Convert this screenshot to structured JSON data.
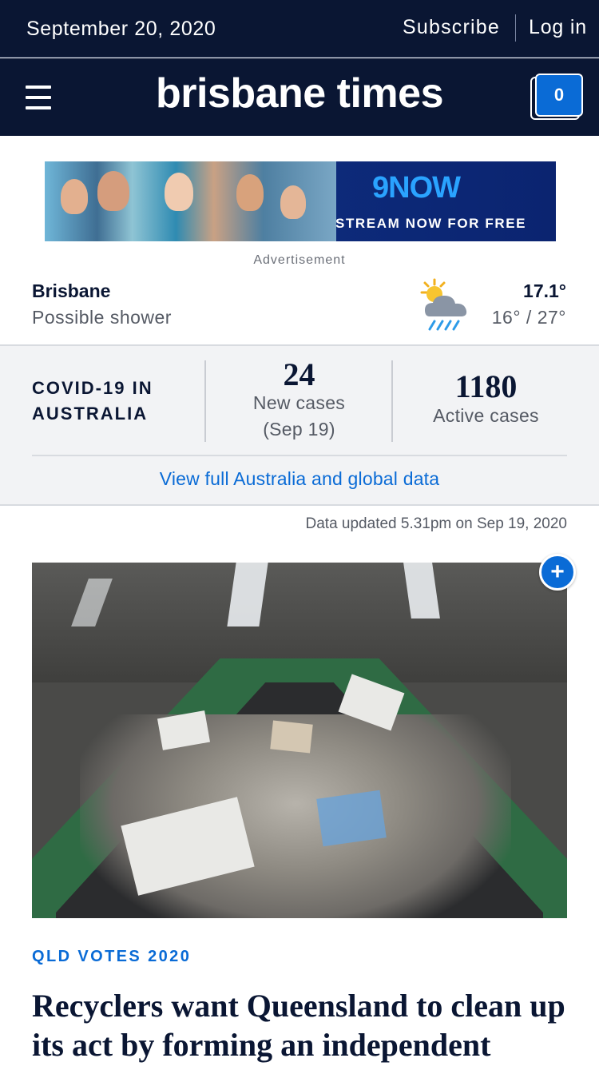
{
  "header": {
    "date": "September 20, 2020",
    "subscribe_label": "Subscribe",
    "login_label": "Log in"
  },
  "masthead": {
    "logo_text": "brisbane times",
    "menu_icon": "hamburger-menu-icon",
    "saved_count": "0"
  },
  "ad": {
    "brand_text": "9NOW",
    "tagline": "STREAM NOW FOR FREE",
    "label": "Advertisement"
  },
  "weather": {
    "city": "Brisbane",
    "condition": "Possible shower",
    "icon": "sun-cloud-rain-icon",
    "current_temp": "17.1°",
    "range": "16° / 27°"
  },
  "covid": {
    "title": "COVID-19 IN AUSTRALIA",
    "new_cases_value": "24",
    "new_cases_label": "New cases",
    "new_cases_date": "(Sep 19)",
    "active_cases_value": "1180",
    "active_cases_label": "Active cases",
    "link_text": "View full Australia and global data",
    "updated_text": "Data updated 5.31pm on Sep 19, 2020"
  },
  "article": {
    "save_icon": "plus-icon",
    "kicker": "QLD VOTES 2020",
    "headline": "Recyclers want Queensland to clean up its act by forming an independent"
  },
  "colors": {
    "navy": "#0a1633",
    "link_blue": "#0a6bd6",
    "panel_grey": "#f2f3f5"
  }
}
